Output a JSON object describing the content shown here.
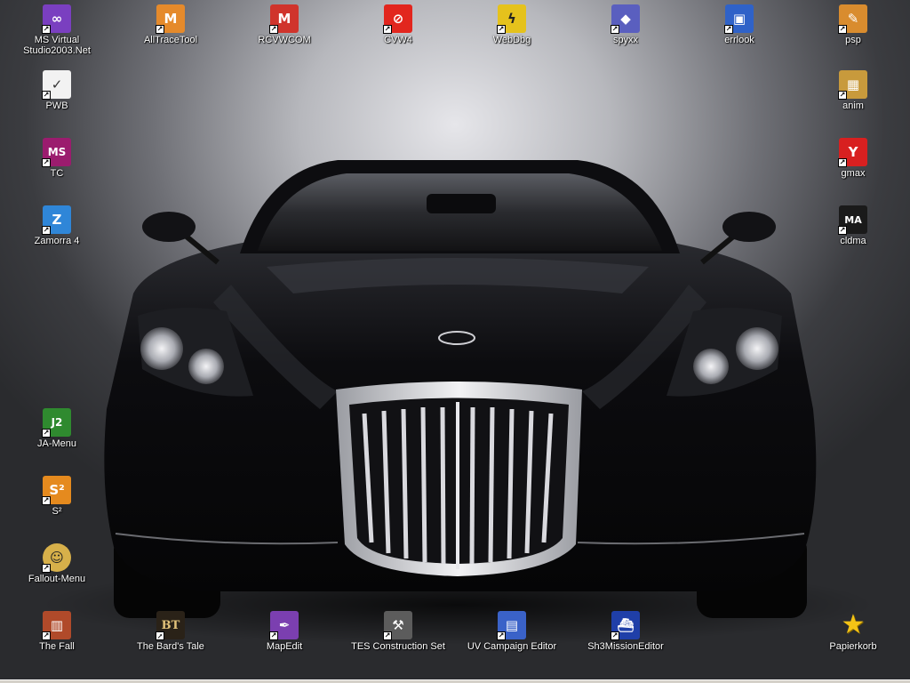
{
  "desktop": {
    "icons": [
      {
        "label": "MS Virtual Studio2003.Net",
        "glyph": "∞",
        "icon": "visual-studio-icon",
        "color": "#7a3fc0",
        "shortcut": true
      },
      {
        "label": "AllTraceTool",
        "glyph": "M",
        "icon": "trace-tool-icon",
        "color": "#e58a2b",
        "shortcut": true
      },
      {
        "label": "RCVWCOM",
        "glyph": "M",
        "icon": "rcvwcom-icon",
        "color": "#d0342c",
        "shortcut": true
      },
      {
        "label": "CVW4",
        "glyph": "⊘",
        "icon": "cvw4-icon",
        "color": "#e2261e",
        "shortcut": true
      },
      {
        "label": "WebDbg",
        "glyph": "ϟ",
        "icon": "webdbg-icon",
        "color": "#e5c21c",
        "shortcut": true
      },
      {
        "label": "spyxx",
        "glyph": "◆",
        "icon": "spyxx-icon",
        "color": "#5a5fbf",
        "shortcut": true
      },
      {
        "label": "errlook",
        "glyph": "▣",
        "icon": "errlook-icon",
        "color": "#2f62c8",
        "shortcut": true
      },
      {
        "label": "psp",
        "glyph": "✎",
        "icon": "psp-icon",
        "color": "#d98c2e",
        "shortcut": true
      },
      {
        "label": "PWB",
        "glyph": "✓",
        "icon": "pwb-icon",
        "color": "#f2f2f2",
        "shortcut": true
      },
      {
        "label": "anim",
        "glyph": "▦",
        "icon": "anim-icon",
        "color": "#c89a3c",
        "shortcut": true
      },
      {
        "label": "TC",
        "glyph": "MS",
        "icon": "tc-icon",
        "color": "#9b1c6e",
        "shortcut": true
      },
      {
        "label": "gmax",
        "glyph": "Y",
        "icon": "gmax-icon",
        "color": "#d82020",
        "shortcut": true
      },
      {
        "label": "Zamorra 4",
        "glyph": "Z",
        "icon": "zamorra-icon",
        "color": "#2f86d8",
        "shortcut": true
      },
      {
        "label": "cldma",
        "glyph": "MA",
        "icon": "cldma-icon",
        "color": "#1a1a1a",
        "shortcut": true
      },
      {
        "label": "JA-Menu",
        "glyph": "J2",
        "icon": "ja-menu-icon",
        "color": "#2f8a2f",
        "shortcut": true
      },
      {
        "label": "S²",
        "glyph": "S²",
        "icon": "s2-icon",
        "color": "#e58a1e",
        "shortcut": true
      },
      {
        "label": "Fallout-Menu",
        "glyph": "☺",
        "icon": "fallout-menu-icon",
        "color": "#d7b04a",
        "shortcut": true
      },
      {
        "label": "The Fall",
        "glyph": "▥",
        "icon": "the-fall-icon",
        "color": "#b04a2a",
        "shortcut": true
      },
      {
        "label": "The Bard's Tale",
        "glyph": "BT",
        "icon": "bards-tale-icon",
        "color": "#2a2218",
        "shortcut": true
      },
      {
        "label": "MapEdit",
        "glyph": "✒",
        "icon": "mapedit-icon",
        "color": "#7b3fb0",
        "shortcut": true
      },
      {
        "label": "TES Construction Set",
        "glyph": "⚒",
        "icon": "tes-cs-icon",
        "color": "#5c5c5c",
        "shortcut": true
      },
      {
        "label": "UV Campaign Editor",
        "glyph": "▤",
        "icon": "uv-campaign-icon",
        "color": "#3a62c8",
        "shortcut": true
      },
      {
        "label": "Sh3MissionEditor",
        "glyph": "⛴",
        "icon": "sh3-mission-icon",
        "color": "#1f3fa8",
        "shortcut": true
      },
      {
        "label": "Papierkorb",
        "glyph": "★",
        "icon": "recycle-bin-icon",
        "color": "#f3c316",
        "shortcut": false
      }
    ]
  },
  "wallpaper": {
    "icon": "black-sports-car-wallpaper",
    "car_body": "#0b0b0d",
    "chrome": "#d8d8dc"
  }
}
